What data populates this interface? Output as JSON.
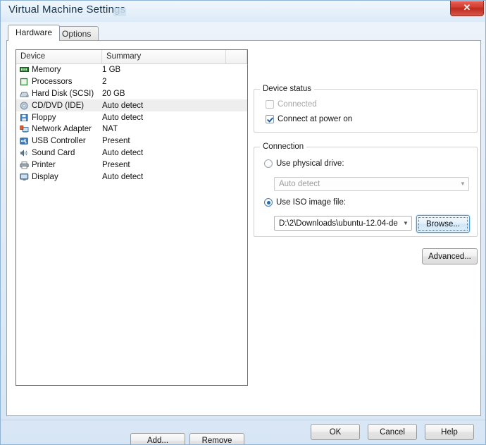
{
  "window": {
    "title": "Virtual Machine Settings",
    "close_label": "✕"
  },
  "tabs": [
    {
      "label": "Hardware",
      "active": true
    },
    {
      "label": "Options",
      "active": false
    }
  ],
  "device_list": {
    "columns": [
      "Device",
      "Summary",
      ""
    ],
    "rows": [
      {
        "icon": "memory-icon",
        "device": "Memory",
        "summary": "1 GB",
        "selected": false
      },
      {
        "icon": "processors-icon",
        "device": "Processors",
        "summary": "2",
        "selected": false
      },
      {
        "icon": "hard-disk-icon",
        "device": "Hard Disk (SCSI)",
        "summary": "20 GB",
        "selected": false
      },
      {
        "icon": "cd-dvd-icon",
        "device": "CD/DVD (IDE)",
        "summary": "Auto detect",
        "selected": true
      },
      {
        "icon": "floppy-icon",
        "device": "Floppy",
        "summary": "Auto detect",
        "selected": false
      },
      {
        "icon": "network-adapter-icon",
        "device": "Network Adapter",
        "summary": "NAT",
        "selected": false
      },
      {
        "icon": "usb-controller-icon",
        "device": "USB Controller",
        "summary": "Present",
        "selected": false
      },
      {
        "icon": "sound-card-icon",
        "device": "Sound Card",
        "summary": "Auto detect",
        "selected": false
      },
      {
        "icon": "printer-icon",
        "device": "Printer",
        "summary": "Present",
        "selected": false
      },
      {
        "icon": "display-icon",
        "device": "Display",
        "summary": "Auto detect",
        "selected": false
      }
    ]
  },
  "list_buttons": {
    "add": "Add...",
    "remove": "Remove"
  },
  "device_status": {
    "title": "Device status",
    "connected": {
      "label": "Connected",
      "checked": false,
      "disabled": true
    },
    "connect_at_power_on": {
      "label": "Connect at power on",
      "checked": true,
      "disabled": false
    }
  },
  "connection": {
    "title": "Connection",
    "physical_drive": {
      "label": "Use physical drive:",
      "selected": false
    },
    "physical_drive_value": "Auto detect",
    "iso_image": {
      "label": "Use ISO image file:",
      "selected": true
    },
    "iso_path": "D:\\2\\Downloads\\ubuntu-12.04-de",
    "browse": "Browse...",
    "advanced": "Advanced..."
  },
  "footer": {
    "ok": "OK",
    "cancel": "Cancel",
    "help": "Help"
  },
  "colors": {
    "accent": "#1d6fb8",
    "close_red": "#d13c2e",
    "selection": "#eeeeee",
    "focus_blue": "#4a9bd4"
  }
}
